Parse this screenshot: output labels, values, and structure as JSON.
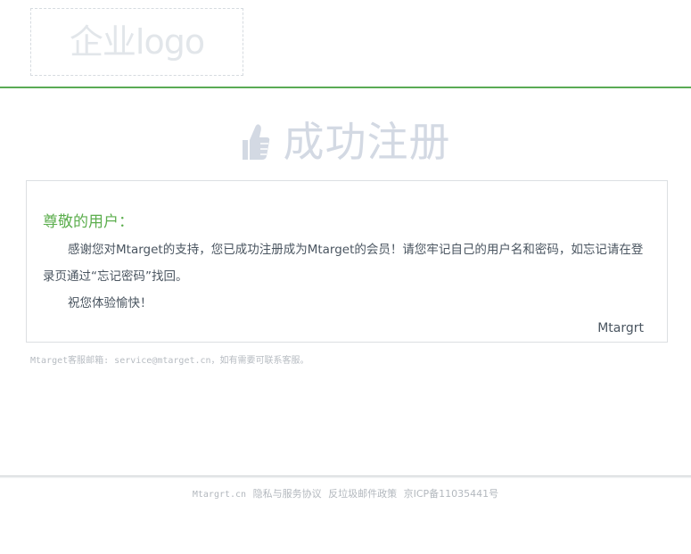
{
  "header": {
    "logo_text": "企业logo",
    "accent_color": "#5aab55"
  },
  "banner": {
    "icon": "thumbs-up-icon",
    "title": "成功注册"
  },
  "card": {
    "greeting": "尊敬的用户：",
    "body": "感谢您对Mtarget的支持，您已成功注册成为Mtarget的会员！请您牢记自己的用户名和密码，如忘记请在登录页通过“忘记密码”找回。",
    "wish": "祝您体验愉快！",
    "signature": "Mtargrt"
  },
  "contact_note": "Mtarget客服邮箱: service@mtarget.cn，如有需要可联系客服。",
  "footer": {
    "domain": "Mtargrt.cn",
    "privacy": "隐私与服务协议",
    "antispam": "反垃圾邮件政策",
    "icp": "京ICP备11035441号"
  }
}
